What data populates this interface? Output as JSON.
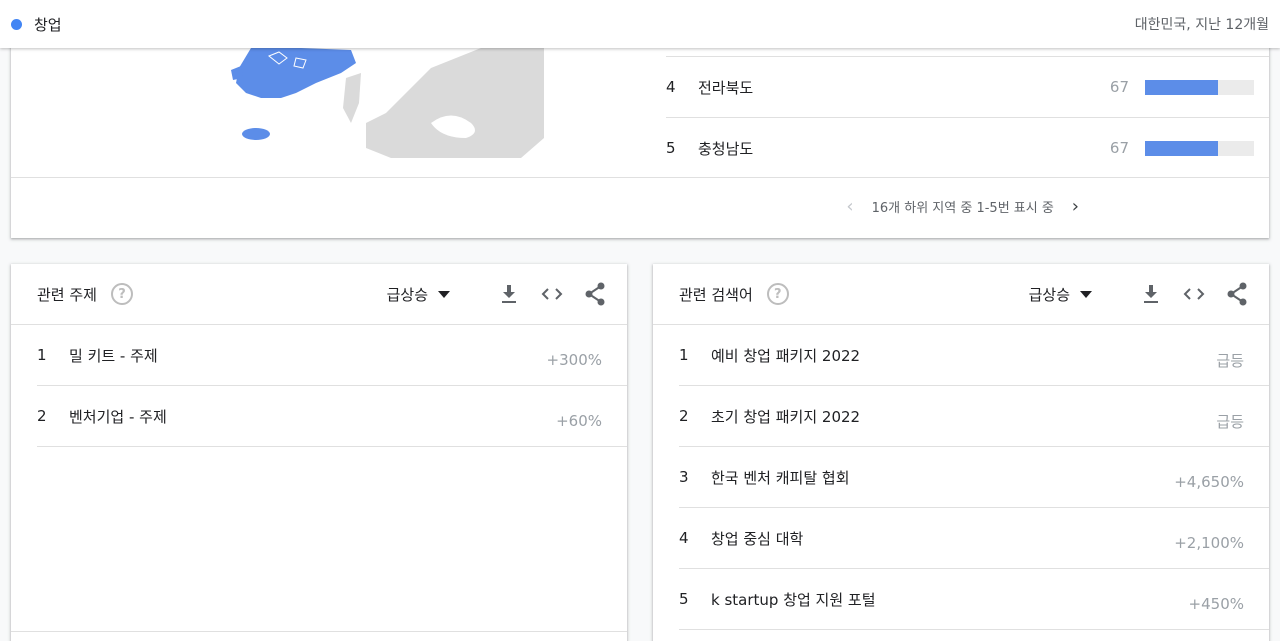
{
  "header": {
    "term": "창업",
    "term_color": "#4285f4",
    "region_time": "대한민국, 지난 12개월"
  },
  "region_card": {
    "rows": [
      {
        "rank": "4",
        "name": "전라북도",
        "value": "67",
        "level": 0.67
      },
      {
        "rank": "5",
        "name": "충청남도",
        "value": "67",
        "level": 0.67
      }
    ],
    "bar_color": "#5c8de8",
    "pager_text": "16개 하위 지역 중 1-5번 표시 중",
    "prev_icon": "chevron-left-icon",
    "next_icon": "chevron-right-icon"
  },
  "related_topics": {
    "title": "관련 주제",
    "selector": "급상승",
    "items": [
      {
        "rank": "1",
        "label": "밀 키트 - 주제",
        "metric": "+300%"
      },
      {
        "rank": "2",
        "label": "벤처기업 - 주제",
        "metric": "+60%"
      }
    ]
  },
  "related_queries": {
    "title": "관련 검색어",
    "selector": "급상승",
    "items": [
      {
        "rank": "1",
        "label": "예비 창업 패키지 2022",
        "metric": "급등"
      },
      {
        "rank": "2",
        "label": "초기 창업 패키지 2022",
        "metric": "급등"
      },
      {
        "rank": "3",
        "label": "한국 벤처 캐피탈 협회",
        "metric": "+4,650%"
      },
      {
        "rank": "4",
        "label": "창업 중심 대학",
        "metric": "+2,100%"
      },
      {
        "rank": "5",
        "label": "k startup 창업 지원 포털",
        "metric": "+450%"
      }
    ]
  },
  "icons": {
    "help": "help-icon",
    "dropdown": "caret-down-icon",
    "download": "download-icon",
    "embed": "embed-code-icon",
    "share": "share-icon"
  }
}
